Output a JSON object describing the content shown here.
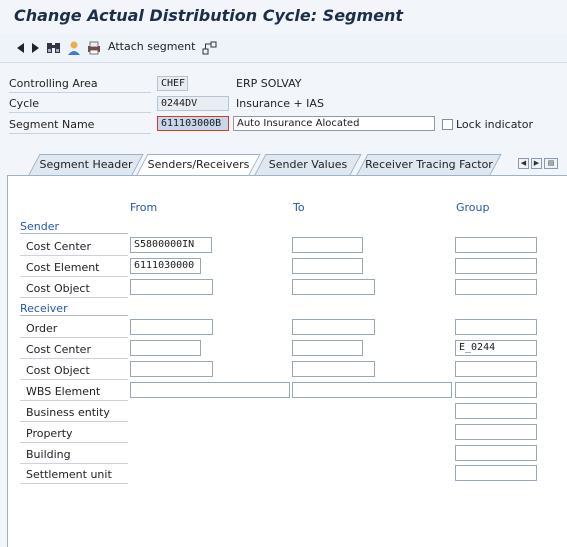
{
  "title": "Change Actual Distribution Cycle: Segment",
  "toolbar": {
    "attach_label": "Attach segment",
    "icons": [
      "triangle-left-icon",
      "triangle-right-icon",
      "binoculars-icon",
      "user-icon",
      "print-icon",
      "hierarchy-icon"
    ]
  },
  "header": {
    "controlling_area": {
      "label": "Controlling Area",
      "value": "CHEF",
      "desc": "ERP SOLVAY"
    },
    "cycle": {
      "label": "Cycle",
      "value": "0244DV",
      "desc": "Insurance + IAS"
    },
    "segment": {
      "label": "Segment Name",
      "value": "611103000B",
      "desc": "Auto Insurance Alocated",
      "lock_label": "Lock indicator"
    }
  },
  "tabs": [
    "Segment Header",
    "Senders/Receivers",
    "Sender Values",
    "Receiver Tracing Factor"
  ],
  "active_tab": "Senders/Receivers",
  "columns": {
    "from": "From",
    "to": "To",
    "group": "Group"
  },
  "sender": {
    "title": "Sender",
    "rows": [
      {
        "label": "Cost Center",
        "from": "S5800000IN",
        "to": "",
        "group": ""
      },
      {
        "label": "Cost Element",
        "from": "6111030000",
        "to": "",
        "group": ""
      },
      {
        "label": "Cost Object",
        "from": "",
        "to": "",
        "group": ""
      }
    ]
  },
  "receiver": {
    "title": "Receiver",
    "rows": [
      {
        "label": "Order",
        "from": "",
        "to": "",
        "group": ""
      },
      {
        "label": "Cost Center",
        "from": "",
        "to": "",
        "group": "E_0244"
      },
      {
        "label": "Cost Object",
        "from": "",
        "to": "",
        "group": ""
      },
      {
        "label": "WBS Element",
        "from": "",
        "to": "",
        "group": ""
      },
      {
        "label": "Business entity",
        "group": ""
      },
      {
        "label": "Property",
        "group": ""
      },
      {
        "label": "Building",
        "group": ""
      },
      {
        "label": "Settlement unit",
        "group": ""
      }
    ]
  },
  "colors": {
    "title": "#1c2e4a",
    "section": "#2554b5",
    "selection_border": "#d23a2a"
  }
}
